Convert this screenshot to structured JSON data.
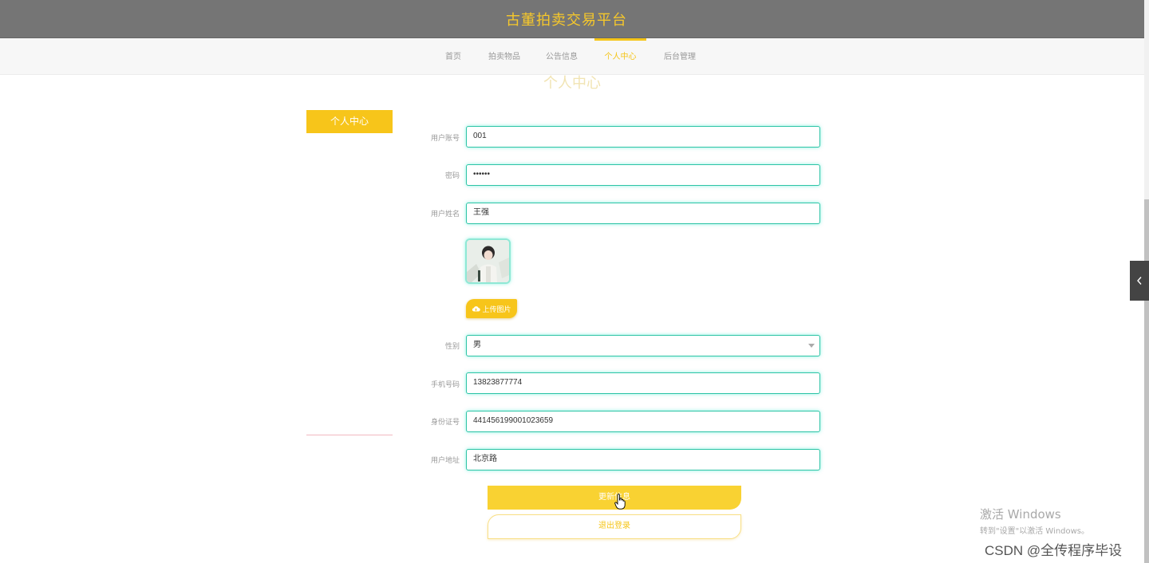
{
  "header": {
    "title": "古董拍卖交易平台"
  },
  "nav": {
    "items": [
      {
        "label": "首页",
        "active": false
      },
      {
        "label": "拍卖物品",
        "active": false
      },
      {
        "label": "公告信息",
        "active": false
      },
      {
        "label": "个人中心",
        "active": true
      },
      {
        "label": "后台管理",
        "active": false
      }
    ]
  },
  "page": {
    "section_title": "个人中心"
  },
  "sidebar": {
    "active_tab": "个人中心"
  },
  "form": {
    "account": {
      "label": "用户账号",
      "value": "001"
    },
    "password": {
      "label": "密码",
      "value": "••••••"
    },
    "name": {
      "label": "用户姓名",
      "value": "王强"
    },
    "upload_label": "上传图片",
    "gender": {
      "label": "性别",
      "value": "男"
    },
    "phone": {
      "label": "手机号码",
      "value": "13823877774"
    },
    "id_card": {
      "label": "身份证号",
      "value": "441456199001023659"
    },
    "address": {
      "label": "用户地址",
      "value": "北京路"
    }
  },
  "actions": {
    "update_label": "更新信息",
    "logout_label": "退出登录"
  },
  "overlay": {
    "windows_activate_line1": "激活 Windows",
    "windows_activate_line2": "转到\"设置\"以激活 Windows。",
    "watermark": "CSDN @全传程序毕设"
  },
  "colors": {
    "accent": "#f5c518",
    "header_bg": "#757575",
    "input_border": "#2ec4a6"
  },
  "icons": {
    "upload": "cloud-upload-icon",
    "toggle": "chevron-left-icon",
    "select": "caret-down-icon"
  }
}
